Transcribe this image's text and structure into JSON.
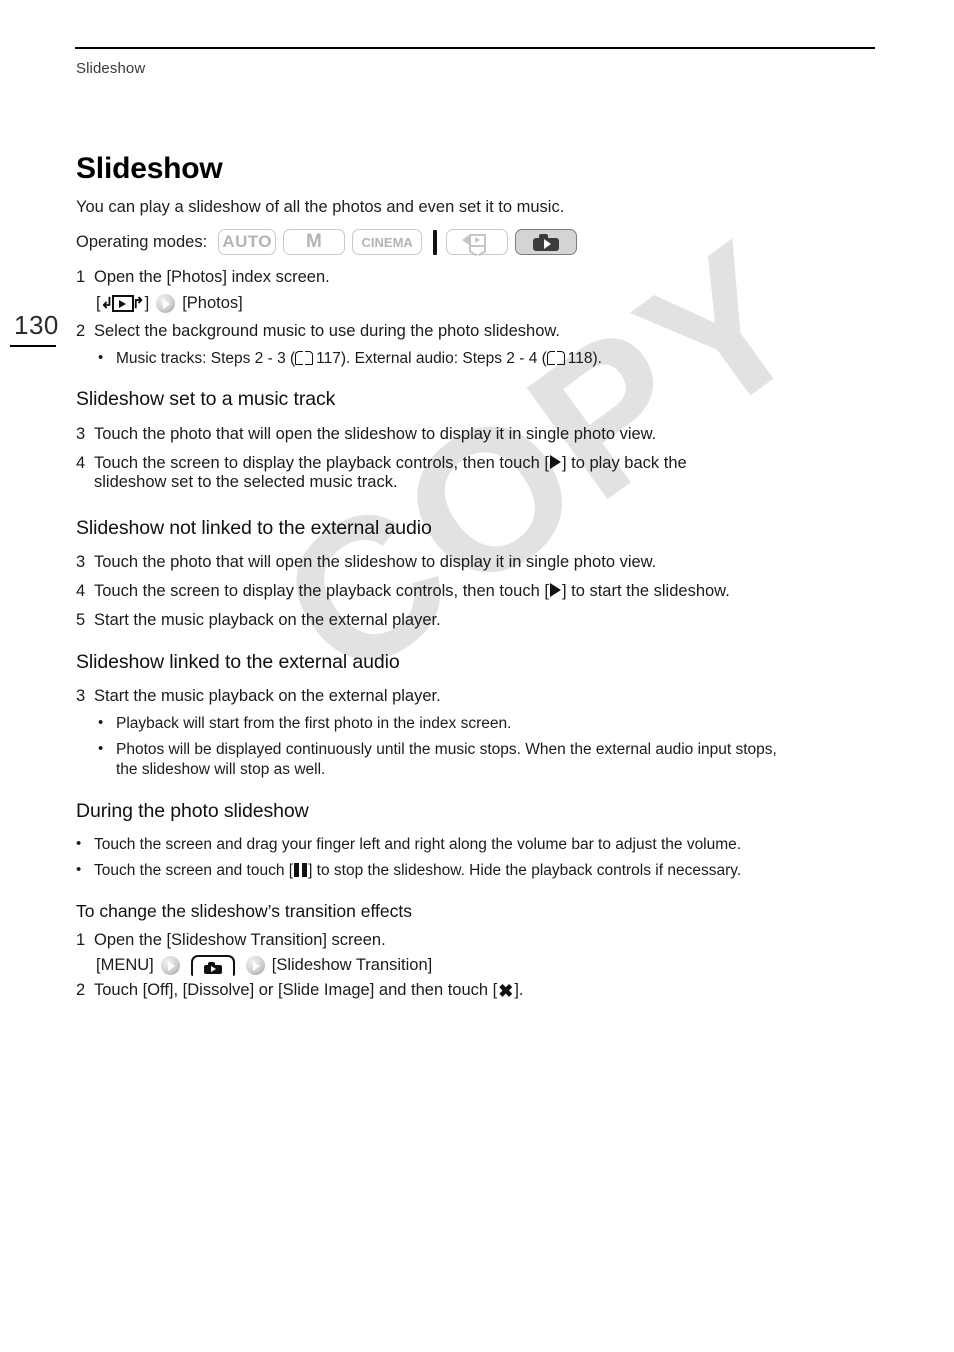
{
  "page": {
    "running_head": "Slideshow",
    "folio": "130",
    "watermark": "COPY"
  },
  "title": "Slideshow",
  "intro": "You can play a slideshow of all the photos and even set it to music.",
  "operating_modes": {
    "label": "Operating modes:",
    "chips": [
      {
        "name": "auto-mode",
        "text": "AUTO",
        "selected": false
      },
      {
        "name": "manual-mode",
        "text": "M",
        "selected": false
      },
      {
        "name": "cinema-mode",
        "text": "CINEMA",
        "selected": false
      },
      {
        "name": "video-playback-mode",
        "text": "",
        "selected": false
      },
      {
        "name": "photo-playback-mode",
        "text": "",
        "selected": true
      }
    ]
  },
  "steps_top": {
    "step1_num": "1",
    "step1_text": "Open the [Photos] index screen.",
    "step1_path_prefix": "[",
    "step1_path_suffix": "]",
    "step1_path_target": "[Photos]",
    "step2_num": "2",
    "step2_text": "Select the background music to use during the photo slideshow.",
    "step2_bullet_a": "Music tracks: Steps 2 - 3 (",
    "step2_bullet_page_a": "117). External audio: Steps 2 - 4 (",
    "step2_bullet_page_b": "118)."
  },
  "section_music_track": {
    "heading": "Slideshow set to a music track",
    "step3_num": "3",
    "step3_text": "Touch the photo that will open the slideshow to display it in single photo view.",
    "step4_num": "4",
    "step4_pre": "Touch the screen to display the playback controls, then touch [",
    "step4_post": "] to play back the",
    "step4_line2": "slideshow set to the selected music track."
  },
  "section_not_linked": {
    "heading": "Slideshow not linked to the external audio",
    "step3_num": "3",
    "step3_text": "Touch the photo that will open the slideshow to display it in single photo view.",
    "step4_num": "4",
    "step4_pre": "Touch the screen to display the playback controls, then touch [",
    "step4_post": "] to start the slideshow.",
    "step5_num": "5",
    "step5_text": "Start the music playback on the external player."
  },
  "section_linked": {
    "heading": "Slideshow linked to the external audio",
    "step3_num": "3",
    "step3_text": "Start the music playback on the external player.",
    "bullet1": "Playback will start from the first photo in the index screen.",
    "bullet2_line1": "Photos will be displayed continuously until the music stops. When the external audio input stops,",
    "bullet2_line2": "the slideshow will stop as well."
  },
  "section_during": {
    "heading": "During the photo slideshow",
    "bullet1": "Touch the screen and drag your finger left and right along the volume bar to adjust the volume.",
    "bullet2_pre": "Touch the screen and touch [",
    "bullet2_post": "] to stop the slideshow. Hide the playback controls if necessary."
  },
  "section_transition": {
    "heading": "To change the slideshow’s transition effects",
    "step1_num": "1",
    "step1_text": "Open the [Slideshow Transition] screen.",
    "step1_menu": "[MENU]",
    "step1_target": "[Slideshow Transition]",
    "step2_num": "2",
    "step2_pre": "Touch [Off], [Dissolve] or [Slide Image] and then touch [",
    "step2_post": "]."
  }
}
